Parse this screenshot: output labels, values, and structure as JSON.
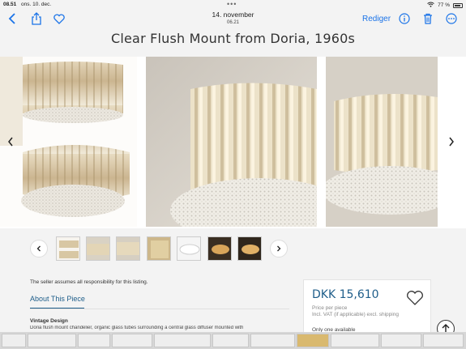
{
  "status_bar": {
    "time": "08.51",
    "date": "ons. 10. dec.",
    "battery": "77 %"
  },
  "toolbar": {
    "date_main": "14. november",
    "date_sub": "06.21",
    "edit_label": "Rediger"
  },
  "page_title": "Clear Flush Mount from Doria, 1960s",
  "gallery": {
    "prev_icon": "chevron-left-icon",
    "next_icon": "chevron-right-icon"
  },
  "thumbnails": {
    "count": 7
  },
  "listing": {
    "disclaimer": "The seller assumes all responsibility for this listing.",
    "about_tab": "About This Piece",
    "section_heading": "Vintage Design",
    "description": "Doria flush mount chandelier, organic glass tubes surrounding a central glass diffuser mounted with"
  },
  "price_card": {
    "price": "DKK 15,610",
    "price_note": "Price per piece",
    "vat_note": "Incl. VAT (if applicable) excl. shipping",
    "availability": "Only one available"
  },
  "colors": {
    "accent": "#1a73e8",
    "brand_blue": "#1f5e8a"
  }
}
